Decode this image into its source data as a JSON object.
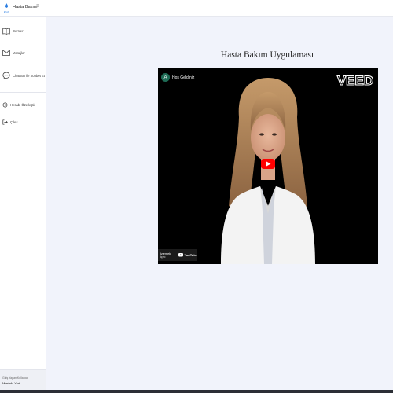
{
  "header": {
    "app_name": "Hasta Bakım",
    "logo_text": "Kuri",
    "menu_toggle_glyph": "≡"
  },
  "sidebar": {
    "items": [
      {
        "label": "Dersler",
        "icon": "book-icon"
      },
      {
        "label": "Mesajlar",
        "icon": "envelope-icon"
      },
      {
        "label": "ChatBox ile Sohbet Et",
        "icon": "chat-bubble-icon"
      },
      {
        "label": "Hesabı Özelleştir",
        "icon": "gear-icon"
      },
      {
        "label": "Çıkış",
        "icon": "logout-icon"
      }
    ],
    "footer": {
      "login_caption": "Giriş Yapan Kullanıcı",
      "user_name": "Mustafa Yurt"
    }
  },
  "main": {
    "title": "Hasta Bakım Uygulaması"
  },
  "video": {
    "channel_initial": "A",
    "title": "Hoş Geldiniz",
    "watermark": "VEED",
    "watch_on_label": "İzlemek için:",
    "platform_label": "YouTube",
    "play_icon": "play-icon"
  },
  "colors": {
    "accent": "#1a73e8",
    "sidebar_bg": "#ffffff",
    "content_bg": "#f1f3fb",
    "play_red": "#ff0000",
    "avatar_green": "#1e6b55"
  }
}
